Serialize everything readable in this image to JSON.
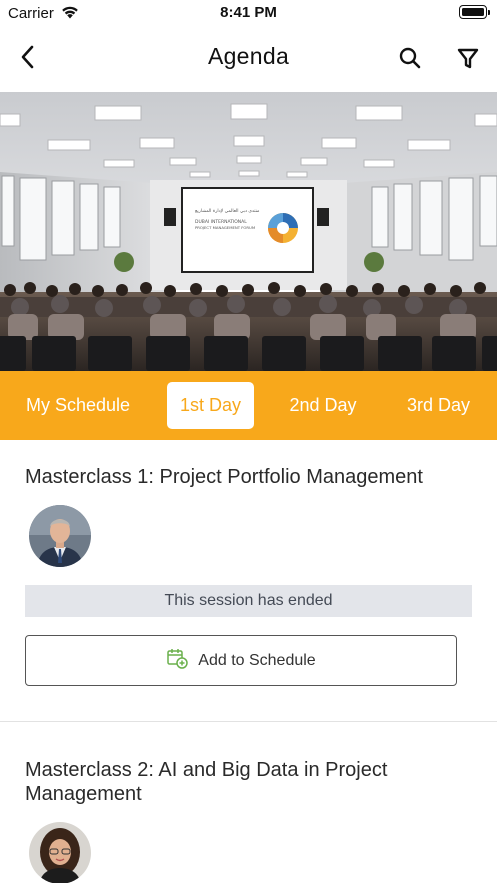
{
  "status_bar": {
    "carrier": "Carrier",
    "time": "8:41 PM"
  },
  "header": {
    "title": "Agenda",
    "icons": [
      "chevron-left-icon",
      "search-icon",
      "filter-icon"
    ]
  },
  "hero": {
    "screen_text_line1": "DUBAI INTERNATIONAL",
    "screen_text_line2": "PROJECT MANAGEMENT FORUM",
    "screen_text_arabic": "منتدى دبي العالمي لإدارة المشاريع"
  },
  "day_tabs": {
    "items": [
      {
        "label": "My Schedule",
        "active": false
      },
      {
        "label": "1st Day",
        "active": true
      },
      {
        "label": "2nd Day",
        "active": false
      },
      {
        "label": "3rd Day",
        "active": false
      }
    ]
  },
  "sessions": [
    {
      "title": "Masterclass 1: Project Portfolio Management",
      "status": "This session has ended",
      "add_label": "Add to Schedule"
    },
    {
      "title": "Masterclass 2: AI and Big Data in Project Management"
    }
  ],
  "colors": {
    "accent": "#f8a81b",
    "banner_bg": "#e3e5ea",
    "add_icon": "#6ab04c"
  }
}
